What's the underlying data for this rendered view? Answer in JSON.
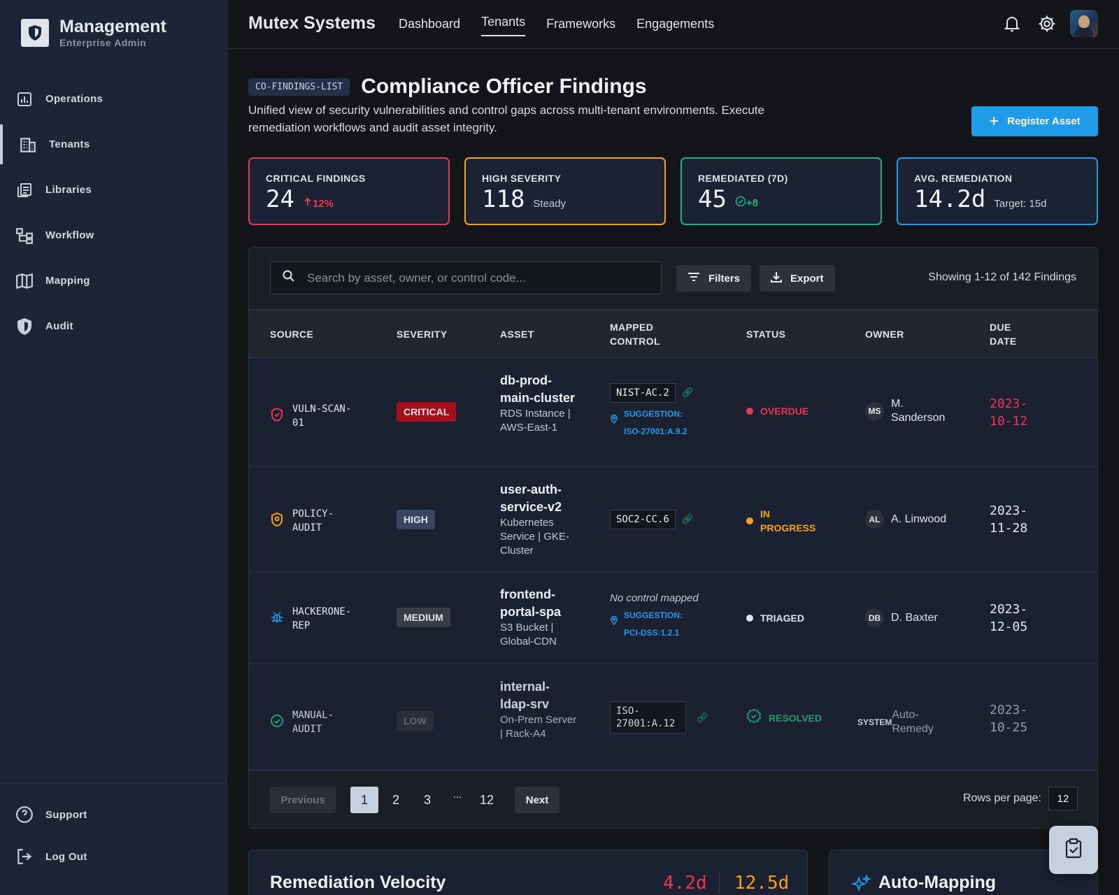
{
  "sidebar": {
    "brand_title": "Management",
    "brand_subtitle": "Enterprise Admin",
    "items": [
      {
        "label": "Operations",
        "icon": "chart-icon"
      },
      {
        "label": "Tenants",
        "icon": "building-icon",
        "active": true
      },
      {
        "label": "Libraries",
        "icon": "library-icon"
      },
      {
        "label": "Workflow",
        "icon": "workflow-icon"
      },
      {
        "label": "Mapping",
        "icon": "map-icon"
      },
      {
        "label": "Audit",
        "icon": "shield-icon"
      }
    ],
    "bottom": [
      {
        "label": "Support",
        "icon": "help-icon"
      },
      {
        "label": "Log Out",
        "icon": "logout-icon"
      }
    ]
  },
  "topbar": {
    "app_title": "Mutex Systems",
    "tabs": [
      {
        "label": "Dashboard"
      },
      {
        "label": "Tenants",
        "active": true
      },
      {
        "label": "Frameworks"
      },
      {
        "label": "Engagements"
      }
    ]
  },
  "page": {
    "id_badge": "CO-FINDINGS-LIST",
    "title": "Compliance Officer Findings",
    "description": "Unified view of security vulnerabilities and control gaps across multi-tenant environments. Execute remediation workflows and audit asset integrity.",
    "register_label": "Register Asset"
  },
  "kpis": [
    {
      "label": "CRITICAL FINDINGS",
      "value": "24",
      "note": "12%",
      "note_icon": "arrow-up-icon",
      "color": "#e8384f",
      "note_color": "#e8384f"
    },
    {
      "label": "HIGH SEVERITY",
      "value": "118",
      "note": "Steady",
      "color": "#f5a21b",
      "note_color": "#c8cdd6"
    },
    {
      "label": "REMEDIATED (7D)",
      "value": "45",
      "note": "+8",
      "note_icon": "check-circle-icon",
      "color": "#22b07a",
      "note_color": "#22b07a"
    },
    {
      "label": "AVG. REMEDIATION",
      "value": "14.2d",
      "note": "Target: 15d",
      "color": "#1e9be9",
      "note_color": "#c8cdd6"
    }
  ],
  "table": {
    "search_placeholder": "Search by asset, owner, or control code...",
    "filters_label": "Filters",
    "export_label": "Export",
    "showing": "Showing 1-12 of 142 Findings",
    "headers": {
      "source": "SOURCE",
      "severity": "SEVERITY",
      "asset": "ASSET",
      "mapped_control": "MAPPED CONTROL",
      "status": "STATUS",
      "owner": "OWNER",
      "due_date": "DUE DATE"
    },
    "rows": [
      {
        "source": "VULN-SCAN-01",
        "source_icon": "shield-alert-icon",
        "severity": "CRITICAL",
        "asset_name": "db-prod-main-cluster",
        "asset_meta": "RDS Instance | AWS-East-1",
        "control": "NIST-AC.2",
        "suggestion": "SUGGESTION: ISO-27001:A.9.2",
        "status": "OVERDUE",
        "status_color": "#e8384f",
        "owner_initials": "MS",
        "owner": "M. Sanderson",
        "due": "2023-10-12",
        "due_color": "#e8384f"
      },
      {
        "source": "POLICY-AUDIT",
        "source_icon": "policy-icon",
        "severity": "HIGH",
        "asset_name": "user-auth-service-v2",
        "asset_meta": "Kubernetes Service | GKE-Cluster",
        "control": "SOC2-CC.6",
        "status": "IN PROGRESS",
        "status_color": "#f5a21b",
        "owner_initials": "AL",
        "owner": "A. Linwood",
        "due": "2023-11-28",
        "due_color": "#e6e8eb"
      },
      {
        "source": "HACKERONE-REP",
        "source_icon": "bug-icon",
        "severity": "MEDIUM",
        "asset_name": "frontend-portal-spa",
        "asset_meta": "S3 Bucket | Global-CDN",
        "no_control": "No control mapped",
        "suggestion": "SUGGESTION: PCI-DSS:1.2.1",
        "status": "TRIAGED",
        "status_color": "#dfe3ea",
        "owner_initials": "DB",
        "owner": "D. Baxter",
        "due": "2023-12-05",
        "due_color": "#e6e8eb"
      },
      {
        "source": "MANUAL-AUDIT",
        "source_icon": "check-circle-icon",
        "severity": "LOW",
        "asset_name": "internal-ldap-srv",
        "asset_meta": "On-Prem Server | Rack-A4",
        "control": "ISO-27001:A.12",
        "status": "RESOLVED",
        "status_color": "#22b07a",
        "owner_initials": "SYSTEM",
        "owner": "Auto-Remedy",
        "due": "2023-10-25",
        "due_color": "#a9b0bb"
      }
    ],
    "pager": {
      "previous": "Previous",
      "pages": [
        "1",
        "2",
        "3",
        "...",
        "12"
      ],
      "current": "1",
      "next": "Next",
      "rows_label": "Rows per page:",
      "rows_value": "12"
    }
  },
  "bottom": {
    "velocity_title": "Remediation Velocity",
    "velocity_a": "4.2d",
    "velocity_b": "12.5d",
    "automap_title": "Auto-Mapping"
  }
}
